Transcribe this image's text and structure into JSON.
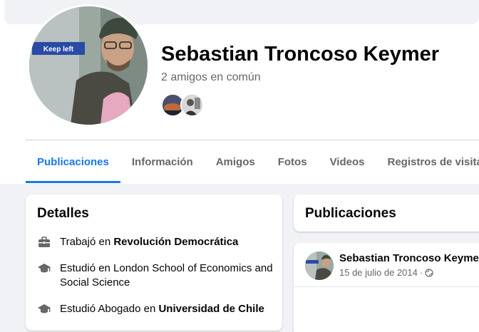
{
  "profile": {
    "name": "Sebastian Troncoso Keymer",
    "mutual_friends": "2 amigos en común",
    "avatar_sign_text": "Keep left"
  },
  "tabs": [
    {
      "label": "Publicaciones",
      "active": true
    },
    {
      "label": "Información",
      "active": false
    },
    {
      "label": "Amigos",
      "active": false
    },
    {
      "label": "Fotos",
      "active": false
    },
    {
      "label": "Videos",
      "active": false
    },
    {
      "label": "Registros de visitas",
      "active": false
    }
  ],
  "details": {
    "title": "Detalles",
    "items": [
      {
        "icon": "briefcase-icon",
        "prefix": "Trabajó en ",
        "bold": "Revolución Democrática"
      },
      {
        "icon": "graduation-cap-icon",
        "prefix": "Estudió en London School of Economics and Social Science",
        "bold": ""
      },
      {
        "icon": "graduation-cap-icon",
        "prefix": "Estudió Abogado en ",
        "bold": "Universidad de Chile"
      }
    ]
  },
  "publications": {
    "title": "Publicaciones",
    "post": {
      "author": "Sebastian Troncoso Keymer",
      "date": "15 de julio de 2014",
      "separator": "·",
      "privacy_icon": "globe-icon"
    }
  },
  "colors": {
    "accent": "#1877f2",
    "background": "#f0f2f5",
    "secondary_text": "#65676b"
  }
}
